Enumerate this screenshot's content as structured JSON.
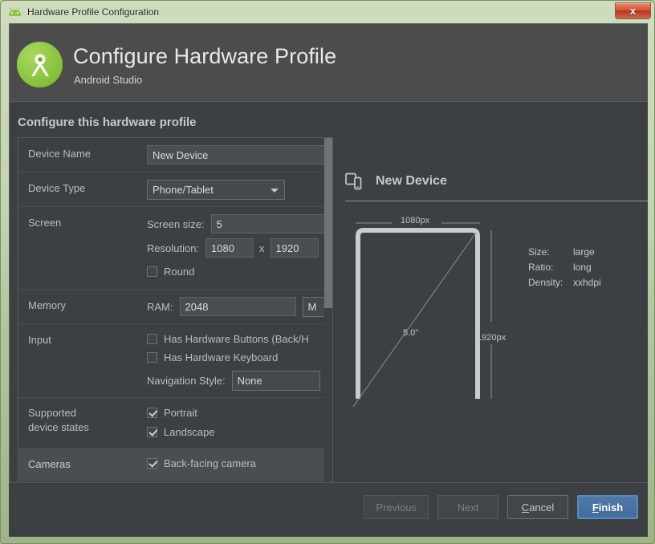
{
  "window": {
    "title": "Hardware Profile Configuration",
    "icon": "android-head-icon",
    "close_label": "x"
  },
  "hero": {
    "icon": "android-studio-logo-icon",
    "title": "Configure Hardware Profile",
    "subtitle": "Android Studio"
  },
  "section_title": "Configure this hardware profile",
  "form": {
    "rows": [
      {
        "label": "Device Name",
        "value": "New Device"
      },
      {
        "label": "Device Type",
        "value": "Phone/Tablet"
      },
      {
        "label": "Screen",
        "screen_size_label": "Screen size:",
        "screen_size_value": "5",
        "resolution_label": "Resolution:",
        "resolution_width": "1080",
        "resolution_separator": "x",
        "resolution_height": "1920",
        "round_label": "Round"
      },
      {
        "label": "Memory",
        "ram_label": "RAM:",
        "ram_value": "2048",
        "ram_unit": "M"
      },
      {
        "label": "Input",
        "hw_buttons_label": "Has Hardware Buttons (Back/H",
        "hw_keyboard_label": "Has Hardware Keyboard",
        "nav_style_label": "Navigation Style:",
        "nav_style_value": "None"
      },
      {
        "label": "Supported\ndevice states",
        "label_line1": "Supported",
        "label_line2": "device states",
        "portrait_label": "Portrait",
        "landscape_label": "Landscape"
      },
      {
        "label": "Cameras",
        "back_camera_label": "Back-facing camera"
      }
    ]
  },
  "preview": {
    "icon": "devices-icon",
    "name": "New Device",
    "width_label": "1080px",
    "height_label": "1920px",
    "diagonal_label": "5.0\"",
    "specs": [
      {
        "key": "Size:",
        "value": "large"
      },
      {
        "key": "Ratio:",
        "value": "long"
      },
      {
        "key": "Density:",
        "value": "xxhdpi"
      }
    ]
  },
  "footer": {
    "previous": "Previous",
    "next": "Next",
    "cancel_prefix": "C",
    "cancel_rest": "ancel",
    "finish_prefix": "F",
    "finish_rest": "inish"
  },
  "colors": {
    "window_chrome": "#c3d2b0",
    "hero_bg": "#4c4c4c",
    "body_bg": "#3c4043",
    "accent_blue": "#4e79a8",
    "android_green": "#8cc63f",
    "close_red": "#d3573a"
  }
}
